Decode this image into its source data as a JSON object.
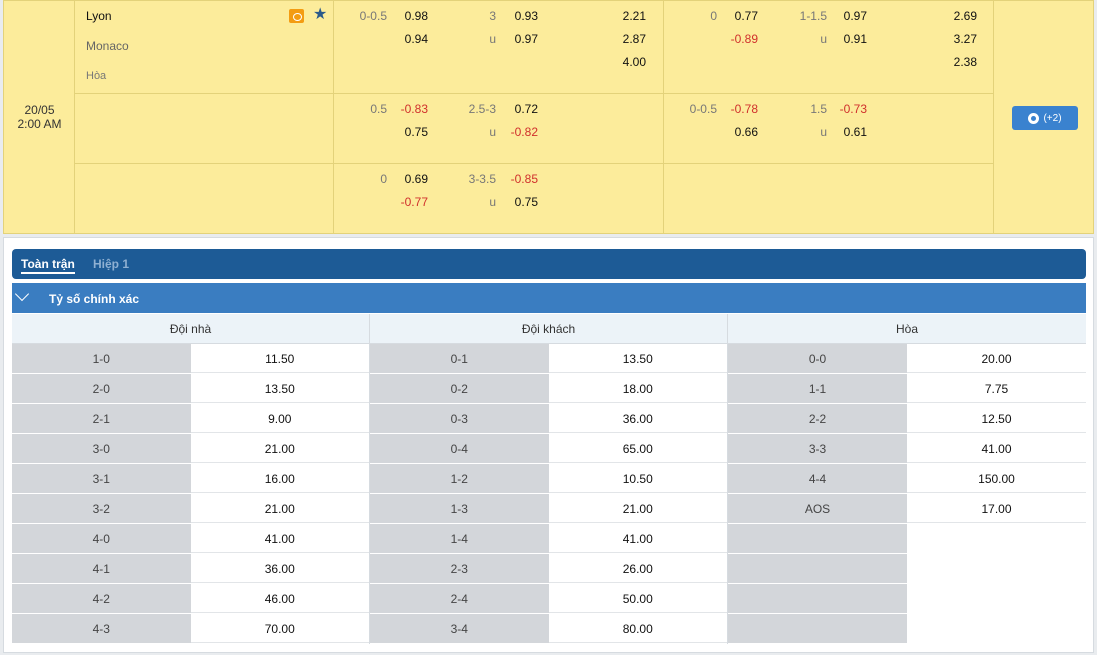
{
  "match": {
    "date": "20/05",
    "time": "2:00 AM",
    "home_team": "Lyon",
    "away_team": "Monaco",
    "draw_label": "Hòa",
    "icons": {
      "live": "live-stream-icon",
      "favorite": "star-icon",
      "more": "football-icon"
    },
    "more_label": "(+2)",
    "rows": [
      {
        "ft_hcap": "0-0.5",
        "ft_hcap_home": "0.98",
        "ft_hcap_away": "0.94",
        "ft_ou": "3",
        "ft_ou_u": "u",
        "ft_ou_over": "0.93",
        "ft_ou_under": "0.97",
        "ft_1x2_home": "2.21",
        "ft_1x2_away": "2.87",
        "ft_1x2_draw": "4.00",
        "h1_hcap": "0",
        "h1_hcap_home": "0.77",
        "h1_hcap_away": "-0.89",
        "h1_ou": "1-1.5",
        "h1_ou_u": "u",
        "h1_ou_over": "0.97",
        "h1_ou_under": "0.91",
        "h1_1x2_home": "2.69",
        "h1_1x2_away": "3.27",
        "h1_1x2_draw": "2.38"
      },
      {
        "ft_hcap": "0.5",
        "ft_hcap_home": "-0.83",
        "ft_hcap_away": "0.75",
        "ft_ou": "2.5-3",
        "ft_ou_u": "u",
        "ft_ou_over": "0.72",
        "ft_ou_under": "-0.82",
        "h1_hcap": "0-0.5",
        "h1_hcap_home": "-0.78",
        "h1_hcap_away": "0.66",
        "h1_ou": "1.5",
        "h1_ou_u": "u",
        "h1_ou_over": "-0.73",
        "h1_ou_under": "0.61"
      },
      {
        "ft_hcap": "0",
        "ft_hcap_home": "0.69",
        "ft_hcap_away": "-0.77",
        "ft_ou": "3-3.5",
        "ft_ou_u": "u",
        "ft_ou_over": "-0.85",
        "ft_ou_under": "0.75"
      }
    ]
  },
  "tabs": {
    "full_match": "Toàn trận",
    "first_half": "Hiệp 1"
  },
  "section": {
    "title": "Tỷ số chính xác",
    "icon": "chevron-down-icon"
  },
  "columns": {
    "home": {
      "header": "Đội nhà",
      "rows": [
        [
          "1-0",
          "11.50"
        ],
        [
          "2-0",
          "13.50"
        ],
        [
          "2-1",
          "9.00"
        ],
        [
          "3-0",
          "21.00"
        ],
        [
          "3-1",
          "16.00"
        ],
        [
          "3-2",
          "21.00"
        ],
        [
          "4-0",
          "41.00"
        ],
        [
          "4-1",
          "36.00"
        ],
        [
          "4-2",
          "46.00"
        ],
        [
          "4-3",
          "70.00"
        ]
      ]
    },
    "away": {
      "header": "Đội khách",
      "rows": [
        [
          "0-1",
          "13.50"
        ],
        [
          "0-2",
          "18.00"
        ],
        [
          "0-3",
          "36.00"
        ],
        [
          "0-4",
          "65.00"
        ],
        [
          "1-2",
          "10.50"
        ],
        [
          "1-3",
          "21.00"
        ],
        [
          "1-4",
          "41.00"
        ],
        [
          "2-3",
          "26.00"
        ],
        [
          "2-4",
          "50.00"
        ],
        [
          "3-4",
          "80.00"
        ]
      ]
    },
    "draw": {
      "header": "Hòa",
      "rows": [
        [
          "0-0",
          "20.00"
        ],
        [
          "1-1",
          "7.75"
        ],
        [
          "2-2",
          "12.50"
        ],
        [
          "3-3",
          "41.00"
        ],
        [
          "4-4",
          "150.00"
        ],
        [
          "AOS",
          "17.00"
        ]
      ]
    }
  },
  "colors": {
    "match_bg": "#fcec9b",
    "tab_bar": "#1d5b96",
    "section_bar": "#3a7dc1",
    "negative_odds": "#d0302c",
    "button": "#3a82cf"
  }
}
